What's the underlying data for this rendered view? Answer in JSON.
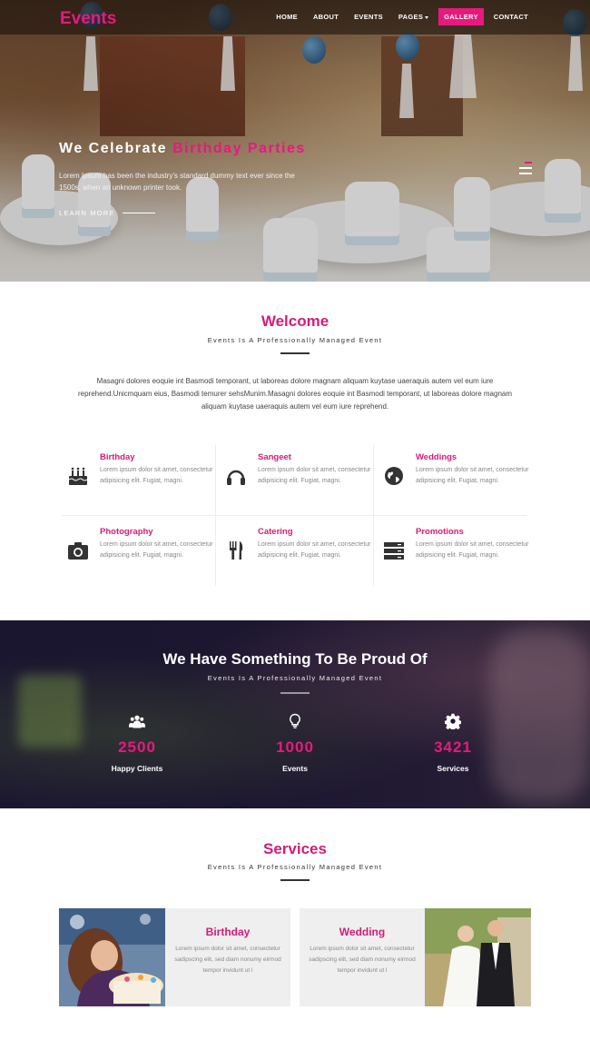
{
  "brand": "Events",
  "nav": [
    {
      "label": "HOME"
    },
    {
      "label": "ABOUT"
    },
    {
      "label": "EVENTS"
    },
    {
      "label": "PAGES"
    },
    {
      "label": "GALLERY"
    },
    {
      "label": "CONTACT"
    }
  ],
  "hero": {
    "title_plain": "We Celebrate",
    "title_highlight": "Birthday Parties",
    "text": "Lorem Ipsum has been the industry's standard dummy text ever since the 1500s, when an unknown printer took.",
    "cta": "LEARN MORE"
  },
  "welcome": {
    "title": "Welcome",
    "subtitle": "Events Is A Professionally Managed Event",
    "text": "Masagni dolores eoquie int Basmodi temporant, ut laboreas dolore magnam aliquam kuytase uaeraquis autem vel eum iure reprehend.Unicmquam eius, Basmodi temurer sehsMunim.Masagni dolores eoquie int Basmodi temporant, ut laboreas dolore magnam aliquam kuytase uaeraquis autem vel eum iure reprehend."
  },
  "features": [
    {
      "title": "Birthday",
      "text": "Lorem ipsum dolor sit amet, consectetur adipisicing elit. Fugiat, magni.",
      "icon": "cake-icon"
    },
    {
      "title": "Sangeet",
      "text": "Lorem ipsum dolor sit amet, consectetur adipisicing elit. Fugiat, magni.",
      "icon": "headphones-icon"
    },
    {
      "title": "Weddings",
      "text": "Lorem ipsum dolor sit amet, consectetur adipisicing elit. Fugiat, magni.",
      "icon": "globe-icon"
    },
    {
      "title": "Photography",
      "text": "Lorem ipsum dolor sit amet, consectetur adipisicing elit. Fugiat, magni.",
      "icon": "camera-icon"
    },
    {
      "title": "Catering",
      "text": "Lorem ipsum dolor sit amet, consectetur adipisicing elit. Fugiat, magni.",
      "icon": "cutlery-icon"
    },
    {
      "title": "Promotions",
      "text": "Lorem ipsum dolor sit amet, consectetur adipisicing elit. Fugiat, magni.",
      "icon": "server-icon"
    }
  ],
  "stats": {
    "title": "We Have Something To Be Proud Of",
    "subtitle": "Events Is A Professionally Managed Event",
    "items": [
      {
        "number": "2500",
        "label": "Happy Clients",
        "icon": "users-icon"
      },
      {
        "number": "1000",
        "label": "Events",
        "icon": "lightbulb-icon"
      },
      {
        "number": "3421",
        "label": "Services",
        "icon": "gear-icon"
      }
    ]
  },
  "services": {
    "title": "Services",
    "subtitle": "Events Is A Professionally Managed Event",
    "items": [
      {
        "title": "Birthday",
        "text": "Lorem ipsum dolor sit amet, consectetur sadipscing elit, sed diam nonumy eirmod tempor invidunt ut l"
      },
      {
        "title": "Wedding",
        "text": "Lorem ipsum dolor sit amet, consectetur sadipscing elit, sed diam nonumy eirmod tempor invidunt ut l"
      }
    ]
  },
  "colors": {
    "accent": "#e8197d",
    "heading": "#d01e78"
  }
}
